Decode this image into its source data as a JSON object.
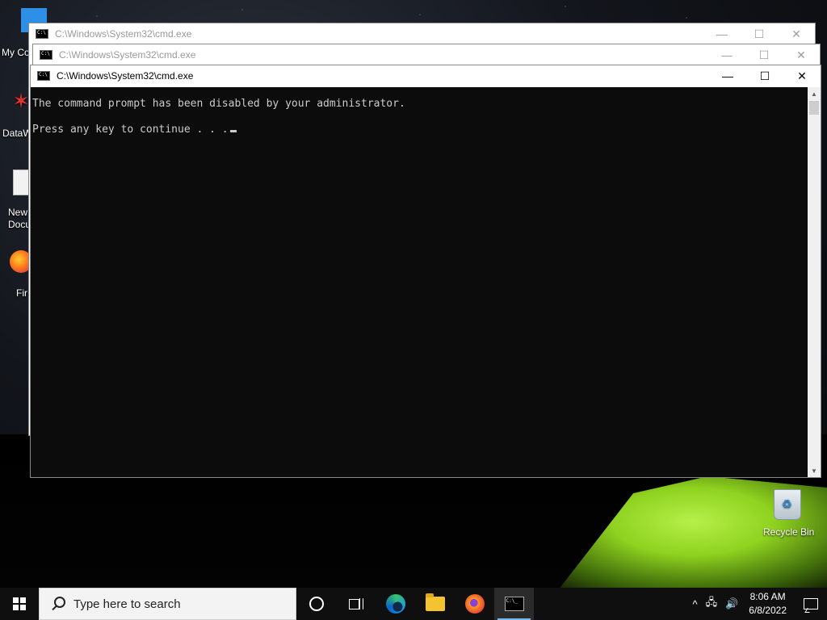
{
  "desktop": {
    "icons": [
      {
        "label": "My Co"
      },
      {
        "label": "DataW"
      },
      {
        "label": "New\nDocu"
      },
      {
        "label": "Fir"
      },
      {
        "label": "Recycle Bin"
      }
    ]
  },
  "windows": [
    {
      "title": "C:\\Windows\\System32\\cmd.exe",
      "state": "inactive"
    },
    {
      "title": "C:\\Windows\\System32\\cmd.exe",
      "state": "inactive"
    },
    {
      "title": "C:\\Windows\\System32\\cmd.exe",
      "state": "active"
    }
  ],
  "window_controls": {
    "minimize": "—",
    "maximize": "☐",
    "close": "✕"
  },
  "console": {
    "lines": [
      "The command prompt has been disabled by your administrator.",
      "Press any key to continue . . ."
    ]
  },
  "taskbar": {
    "search_placeholder": "Type here to search",
    "apps": [
      "cortana-icon",
      "task-view-icon",
      "edge-icon",
      "file-explorer-icon",
      "firefox-icon",
      "cmd-icon"
    ],
    "tray": {
      "chevron": "^",
      "time": "8:06 AM",
      "date": "6/8/2022"
    }
  },
  "colors": {
    "console_bg": "#0c0c0c",
    "console_fg": "#cccccc",
    "taskbar_bg": "#0f0f10",
    "accent": "#76b9ed"
  }
}
